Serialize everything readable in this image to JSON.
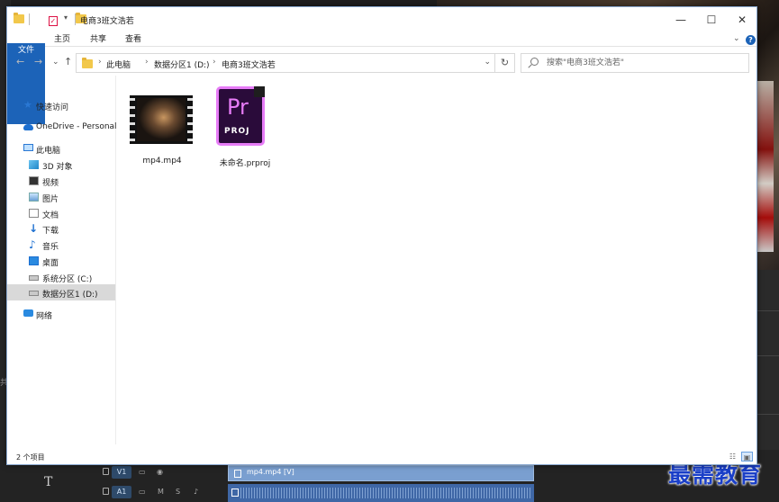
{
  "window": {
    "title": "电商3班文浩若",
    "minimize": "—",
    "maximize": "☐",
    "close": "✕"
  },
  "ribbon": {
    "tabs": [
      "文件",
      "主页",
      "共享",
      "查看"
    ],
    "expand": "⌄",
    "help": "?"
  },
  "address": {
    "back": "←",
    "forward": "→",
    "recent": "⌄",
    "up": "↑",
    "crumbs": [
      "此电脑",
      "数据分区1 (D:)",
      "电商3班文浩若"
    ],
    "sep": "›",
    "dropdown": "⌄",
    "refresh": "↻"
  },
  "search": {
    "placeholder": "搜索\"电商3班文浩若\""
  },
  "nav": {
    "quick_access": "快速访问",
    "onedrive": "OneDrive - Personal",
    "this_pc": "此电脑",
    "objects3d": "3D 对象",
    "videos": "视频",
    "pictures": "图片",
    "documents": "文档",
    "downloads": "下载",
    "music": "音乐",
    "desktop": "桌面",
    "drive_c": "系统分区 (C:)",
    "drive_d": "数据分区1 (D:)",
    "network": "网络"
  },
  "files": [
    {
      "name": "mp4.mp4",
      "type": "video"
    },
    {
      "name": "未命名.prproj",
      "type": "premiere-project"
    }
  ],
  "premiere_icon": {
    "pr": "Pr",
    "proj": "PROJ"
  },
  "status": {
    "count": "2 个项目"
  },
  "timeline": {
    "v1": "V1",
    "a1": "A1",
    "clip": "mp4.mp4 [V]",
    "m": "M",
    "s": "S",
    "tool": "T",
    "side": "共"
  },
  "watermark": "最需教育",
  "colors": {
    "accent": "#1c63b8",
    "premiere_pink": "#e77cf7",
    "folder": "#f2c84b"
  }
}
